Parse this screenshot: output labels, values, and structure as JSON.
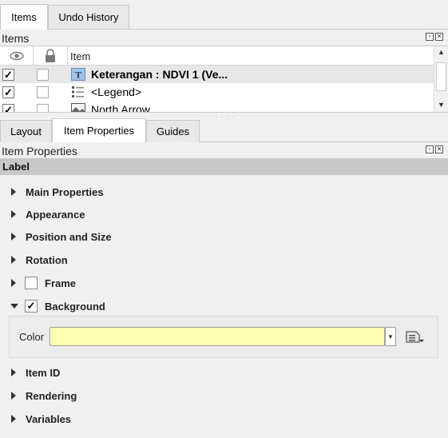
{
  "top_tabs": [
    {
      "label": "Items",
      "active": true
    },
    {
      "label": "Undo History",
      "active": false
    }
  ],
  "items_panel": {
    "title": "Items",
    "columns": {
      "visibility_icon": "eye-icon",
      "lock_icon": "lock-icon",
      "item": "Item"
    },
    "rows": [
      {
        "visible": "✓",
        "locked": "",
        "icon": "text-label-icon",
        "label": "Keterangan : NDVI 1 (Ve...",
        "bold": true
      },
      {
        "visible": "✓",
        "locked": "",
        "icon": "legend-icon",
        "label": "<Legend>",
        "bold": false
      },
      {
        "visible": "✓",
        "locked": "",
        "icon": "picture-icon",
        "label": "North Arrow",
        "bold": false
      }
    ]
  },
  "bottom_tabs": [
    {
      "label": "Layout",
      "active": false
    },
    {
      "label": "Item Properties",
      "active": true
    },
    {
      "label": "Guides",
      "active": false
    }
  ],
  "properties_panel": {
    "title": "Item Properties",
    "header": "Label",
    "sections": [
      {
        "label": "Main Properties",
        "expanded": false
      },
      {
        "label": "Appearance",
        "expanded": false
      },
      {
        "label": "Position and Size",
        "expanded": false
      },
      {
        "label": "Rotation",
        "expanded": false
      },
      {
        "label": "Frame",
        "expanded": false,
        "checkbox": ""
      },
      {
        "label": "Background",
        "expanded": true,
        "checkbox": "✓"
      },
      {
        "label": "Item ID",
        "expanded": false
      },
      {
        "label": "Rendering",
        "expanded": false
      },
      {
        "label": "Variables",
        "expanded": false
      }
    ],
    "background": {
      "color_label": "Color",
      "color_value": "#ffffb1"
    }
  }
}
